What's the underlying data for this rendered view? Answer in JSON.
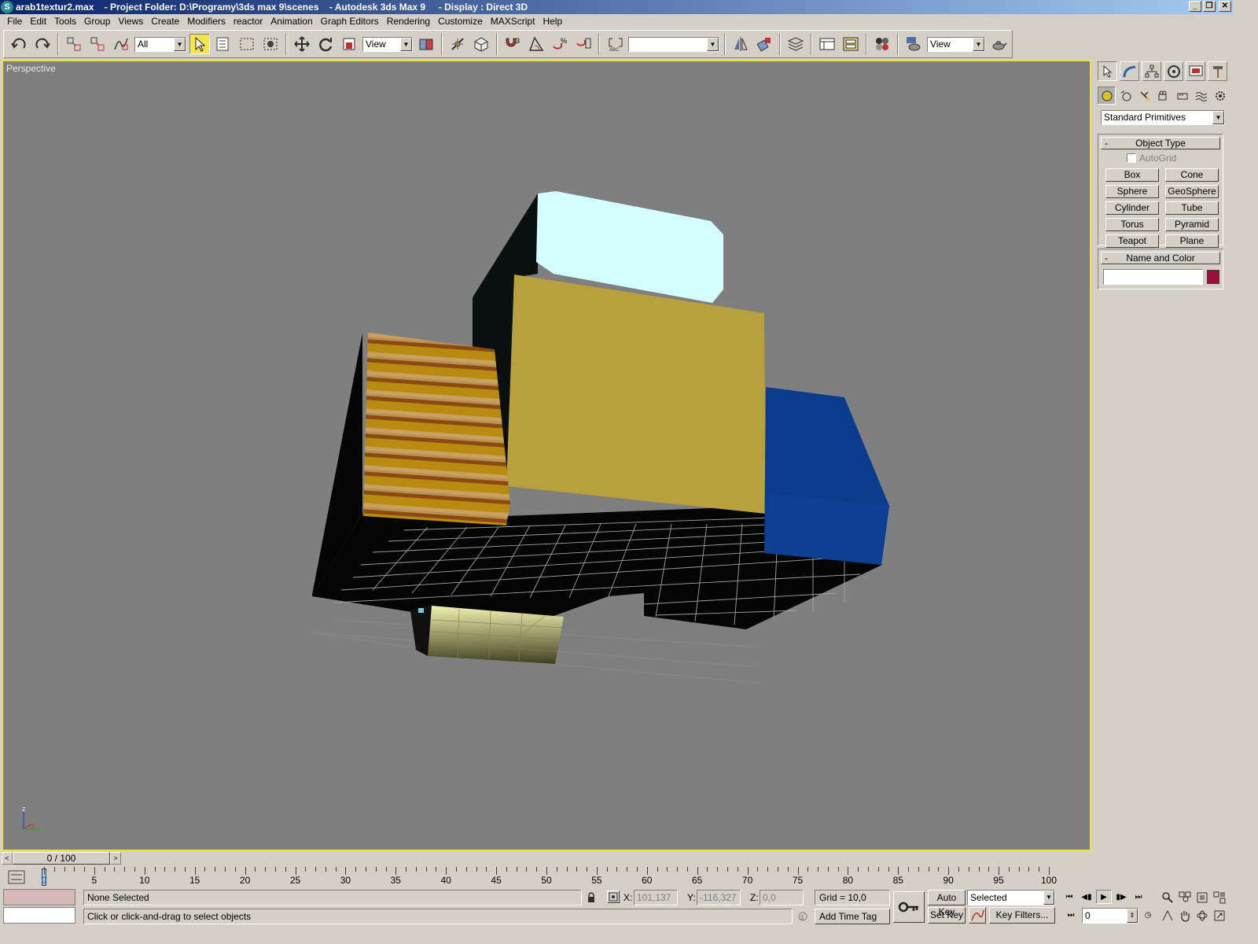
{
  "titlebar": {
    "text": "arab1textur2.max    - Project Folder: D:\\Programy\\3ds max 9\\scenes    - Autodesk 3ds Max 9     - Display : Direct 3D",
    "minimize": "_",
    "restore": "❐",
    "close": "✕"
  },
  "menu": [
    "File",
    "Edit",
    "Tools",
    "Group",
    "Views",
    "Create",
    "Modifiers",
    "reactor",
    "Animation",
    "Graph Editors",
    "Rendering",
    "Customize",
    "MAXScript",
    "Help"
  ],
  "toolbar": {
    "selection_filter": "All",
    "reference_coord": "View",
    "named_selection": "",
    "render_view": "View"
  },
  "viewport": {
    "label": "Perspective",
    "background": "#7f7f7f",
    "border_color": "#f0e050",
    "axis": {
      "x": "x",
      "y": "y",
      "z": "z"
    }
  },
  "command_panel": {
    "category": "Standard Primitives",
    "object_type": {
      "title": "Object Type",
      "autogrid": "AutoGrid",
      "buttons": [
        "Box",
        "Cone",
        "Sphere",
        "GeoSphere",
        "Cylinder",
        "Tube",
        "Torus",
        "Pyramid",
        "Teapot",
        "Plane"
      ]
    },
    "name_color": {
      "title": "Name and Color",
      "name_value": "",
      "color": "#9a1038"
    },
    "collapse_symbol": "-"
  },
  "timeline": {
    "slider_label": "0 / 100",
    "ticks": [
      0,
      5,
      10,
      15,
      20,
      25,
      30,
      35,
      40,
      45,
      50,
      55,
      60,
      65,
      70,
      75,
      80,
      85,
      90,
      95,
      100
    ],
    "prev": "<",
    "next": ">"
  },
  "status": {
    "selection": "None Selected",
    "prompt": "Click or click-and-drag to select objects",
    "x_label": "X:",
    "x_value": "101,137",
    "y_label": "Y:",
    "y_value": "-116,327",
    "z_label": "Z:",
    "z_value": "0,0",
    "grid": "Grid = 10,0",
    "add_time_tag": "Add Time Tag",
    "auto_key": "Auto Key",
    "set_key": "Set Key",
    "key_mode": "Selected",
    "key_filters": "Key Filters...",
    "current_frame": "0"
  }
}
